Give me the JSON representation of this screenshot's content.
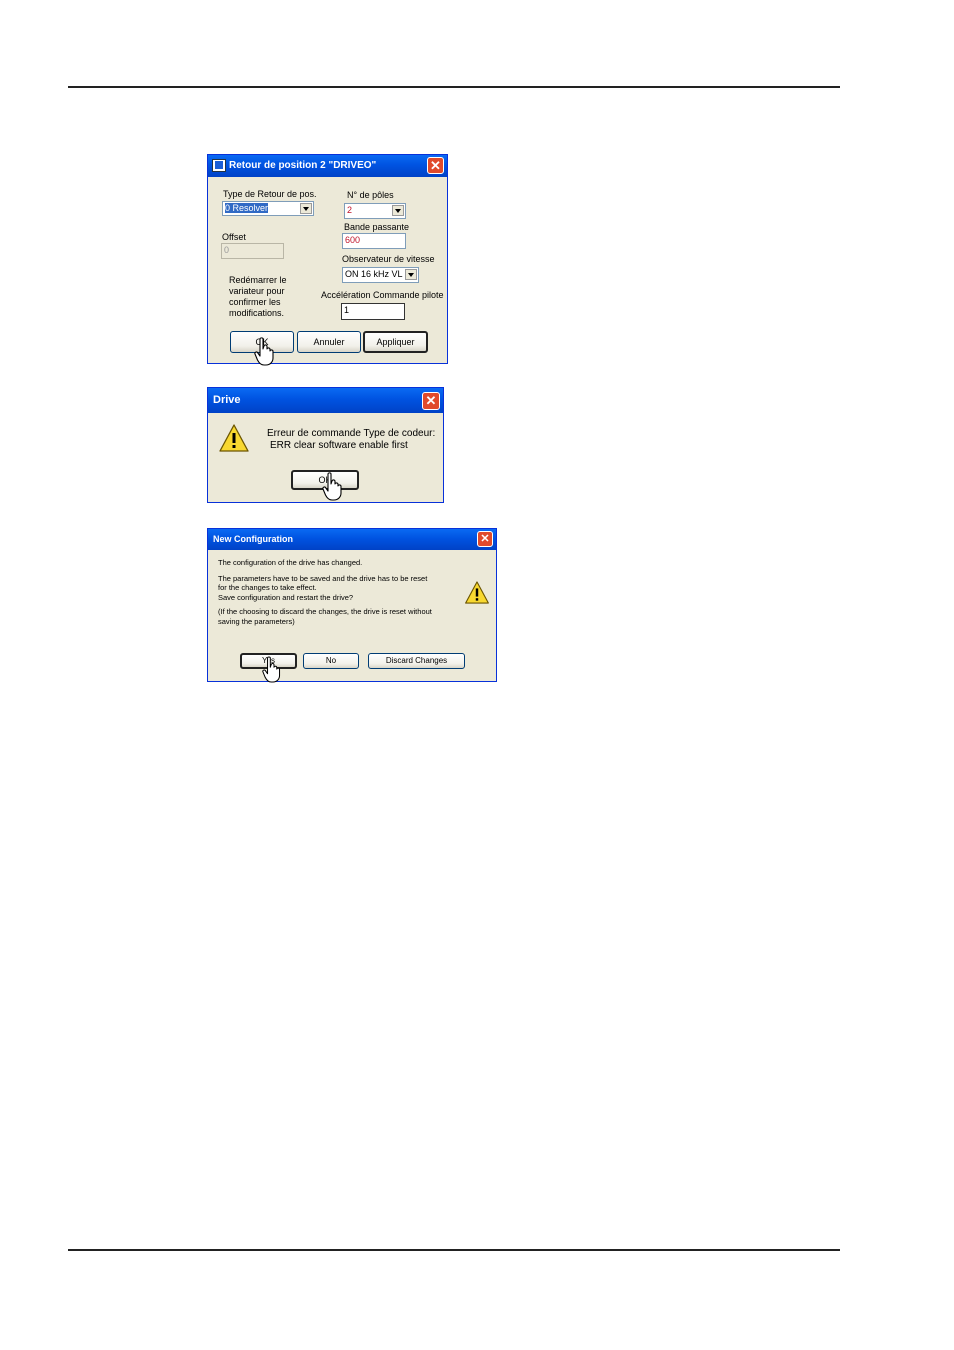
{
  "dialog1": {
    "title": "Retour de position 2 \"DRIVEO\"",
    "app_icon": "app-icon",
    "close_label": "✕",
    "type_label": "Type de Retour de pos.",
    "type_value": "0 Resolver",
    "offset_label": "Offset",
    "offset_value": "0",
    "note": [
      "Redémarrer le",
      "variateur pour",
      "confirmer les",
      "modifications."
    ],
    "poles_label": "N° de pôles",
    "poles_value": "2",
    "bandwidth_label": "Bande passante",
    "bandwidth_value": "600",
    "observer_label": "Observateur de vitesse",
    "observer_value": "ON  16 kHz VL",
    "accel_label": "Accélération Commande pilote",
    "accel_value": "1",
    "ok_label": "OK",
    "cancel_label": "Annuler",
    "apply_label": "Appliquer",
    "value_color": "#c0142a"
  },
  "dialog2": {
    "title": "Drive",
    "close_label": "✕",
    "message_line1": "Erreur de commande Type de codeur:",
    "message_line2": "ERR clear software enable first",
    "ok_label": "OK"
  },
  "dialog3": {
    "title": "New Configuration",
    "close_label": "✕",
    "line1": "The configuration of the drive has changed.",
    "line2": "The parameters have to be saved and the drive has to be reset",
    "line3": "for the changes to take effect.",
    "line4": "Save configuration and restart the drive?",
    "line5": "(If the choosing to discard the changes, the drive is reset without",
    "line6": "saving the parameters)",
    "yes_label": "Yes",
    "no_label": "No",
    "discard_label": "Discard Changes"
  },
  "colors": {
    "titlebar": "#0054e3",
    "dialog_bg": "#ece9d8",
    "close": "#e04a2b"
  }
}
